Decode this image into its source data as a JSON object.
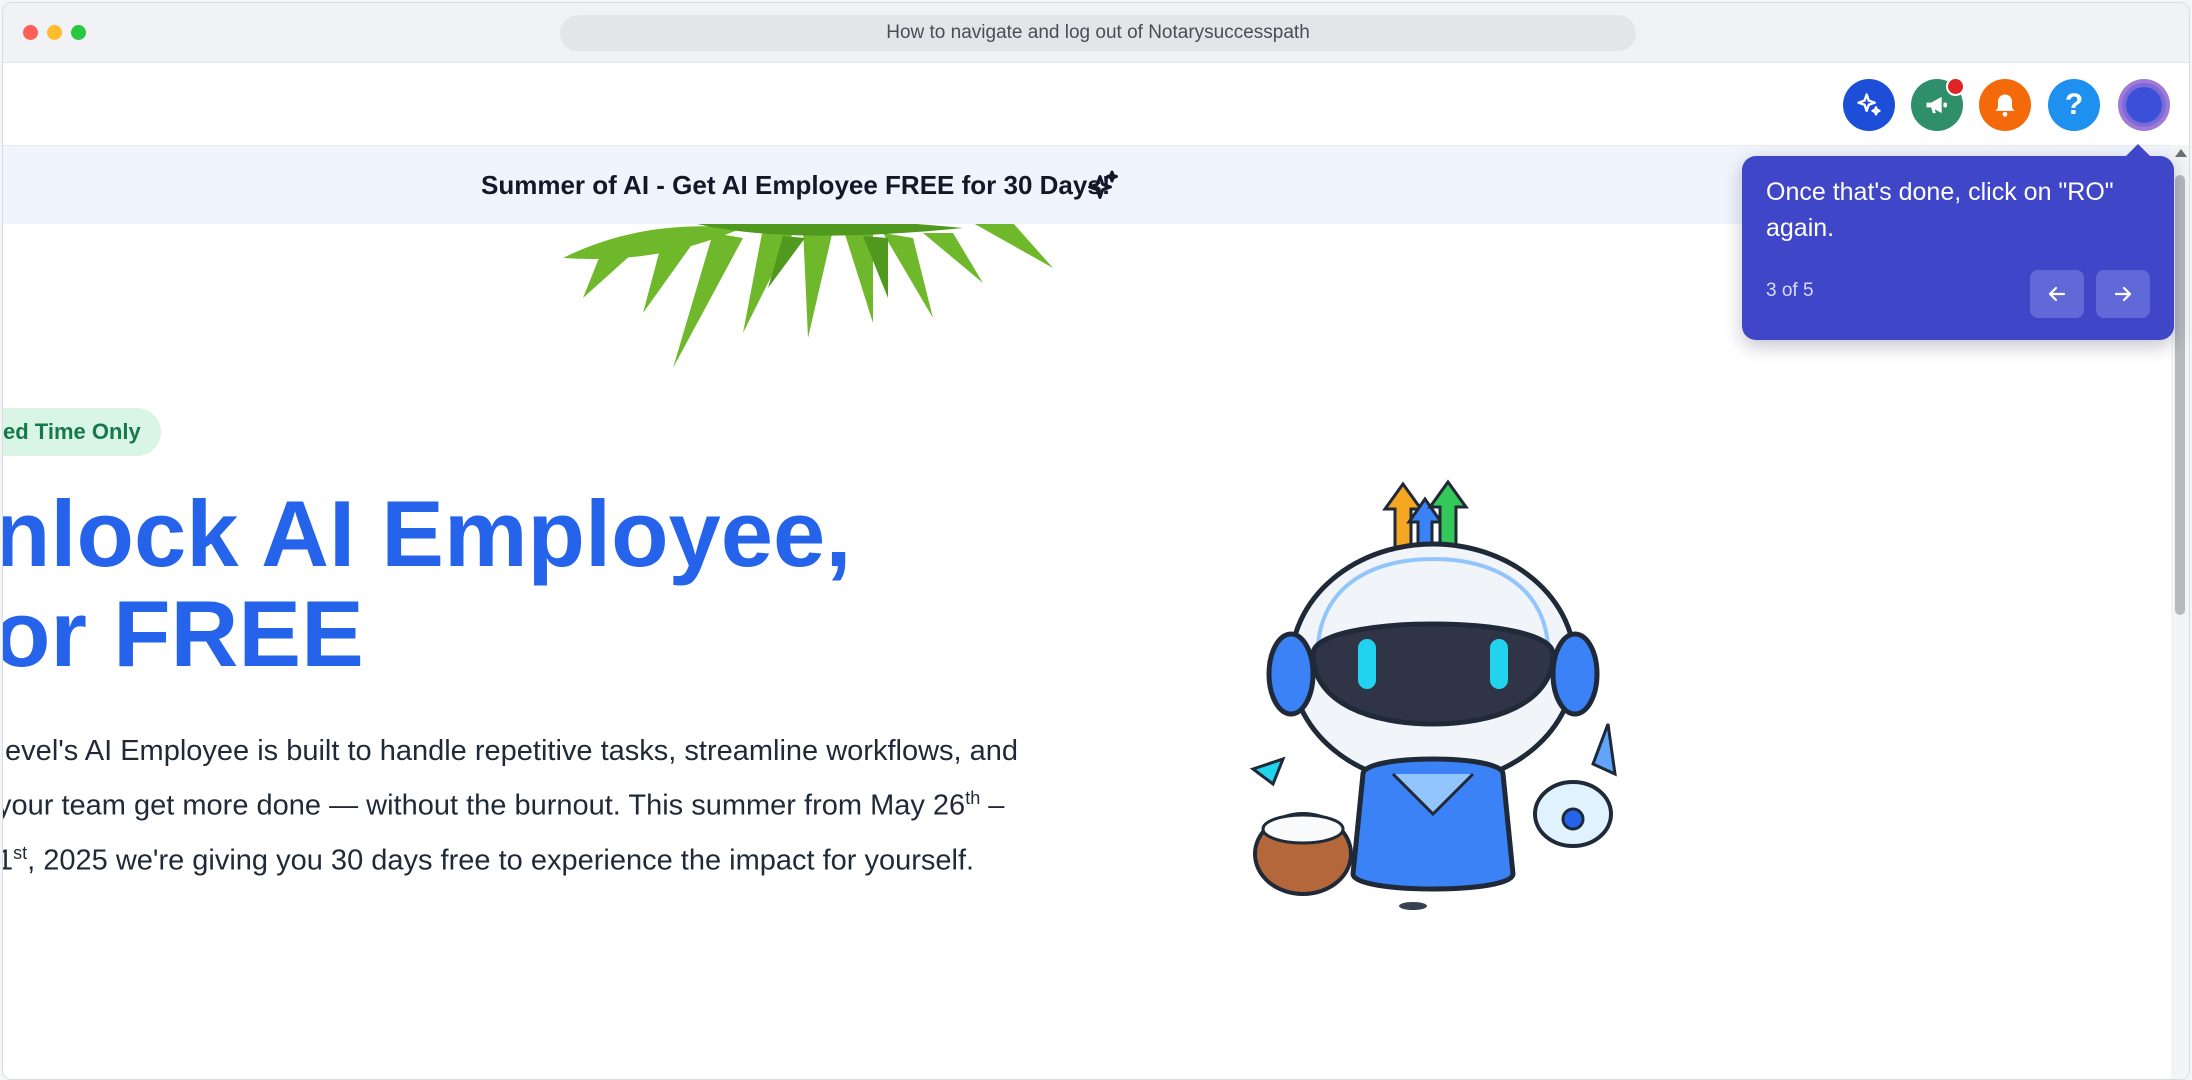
{
  "window": {
    "title": "How to navigate and log out of Notarysuccesspath"
  },
  "header": {
    "icons": [
      "ai-sparkle-icon",
      "megaphone-icon",
      "bell-icon",
      "help-icon",
      "avatar"
    ],
    "help_label": "?"
  },
  "banner": {
    "text": "Summer of AI - Get AI Employee FREE for 30 Days!"
  },
  "hero": {
    "pill": "ed Time Only",
    "headline_line1": "nlock AI Employee,",
    "headline_line2": "or FREE",
    "body_line1": ".evel's AI Employee is built to handle repetitive tasks, streamline workflows, and",
    "body_line2_a": "your team get more done — without the burnout. This summer from May 26",
    "body_line2_sup": "th",
    "body_line2_b": " –",
    "body_line3_a": "1",
    "body_line3_sup": "st",
    "body_line3_b": ", 2025 we're giving you 30 days free to experience the impact for yourself."
  },
  "tooltip": {
    "text": "Once that's done, click on \"RO\" again.",
    "step": "3 of 5"
  },
  "colors": {
    "headline": "#2563eb",
    "tooltip_bg": "#3f46c8",
    "banner_bg": "#eff4fd"
  }
}
